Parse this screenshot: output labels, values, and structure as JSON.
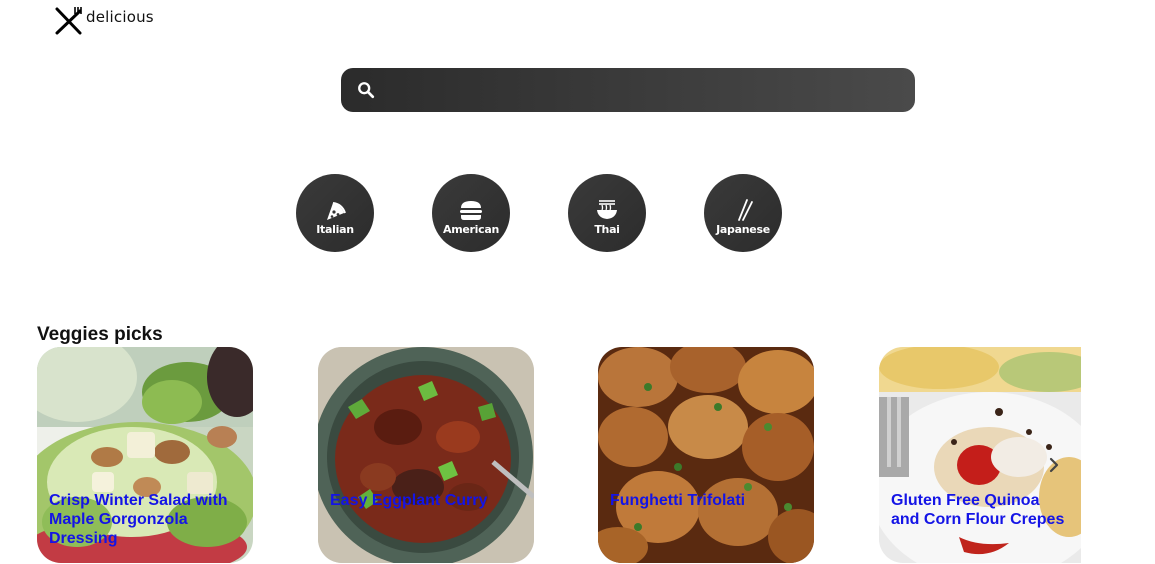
{
  "logo": {
    "text": "delicious",
    "icon": "fork-knife-icon"
  },
  "search": {
    "placeholder": "",
    "value": "",
    "icon": "search-icon"
  },
  "cuisines": [
    {
      "label": "Italian",
      "icon": "pizza-icon"
    },
    {
      "label": "American",
      "icon": "burger-icon"
    },
    {
      "label": "Thai",
      "icon": "noodle-bowl-icon"
    },
    {
      "label": "Japanese",
      "icon": "chopsticks-icon"
    }
  ],
  "section": {
    "title": "Veggies picks"
  },
  "cards": [
    {
      "title": "Crisp Winter Salad with Maple Gorgonzola Dressing",
      "image": "salad-photo"
    },
    {
      "title": "Easy Eggplant Curry",
      "image": "eggplant-curry-photo"
    },
    {
      "title": "Funghetti Trifolati",
      "image": "mushrooms-photo"
    },
    {
      "title": "Gluten Free Quinoa and Corn Flour Crepes",
      "image": "crepes-photo"
    }
  ],
  "colors": {
    "searchBg": "#3a3a3a",
    "cuisineBg": "#333333",
    "cardTitle": "#1414e6"
  }
}
